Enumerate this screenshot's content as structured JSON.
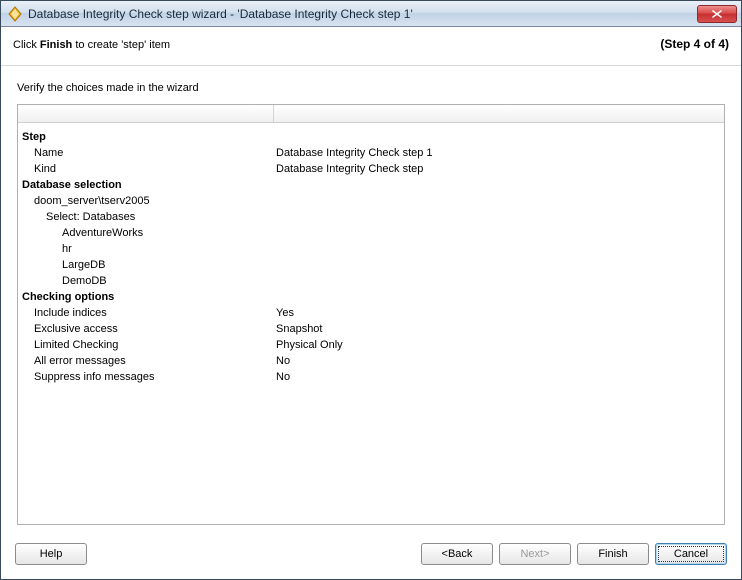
{
  "window": {
    "title": "Database Integrity Check step wizard - 'Database Integrity Check step 1'"
  },
  "subheader": {
    "prefix": "Click ",
    "bold": "Finish",
    "suffix": " to create 'step' item",
    "step": "(Step 4 of 4)"
  },
  "content": {
    "verify_label": "Verify the choices made in the wizard"
  },
  "summary": {
    "step_header": "Step",
    "name_label": "Name",
    "name_value": "Database Integrity Check step 1",
    "kind_label": "Kind",
    "kind_value": "Database Integrity Check step",
    "db_header": "Database selection",
    "server": "doom_server\\tserv2005",
    "select_label": "Select: Databases",
    "databases": [
      "AdventureWorks",
      "hr",
      "LargeDB",
      "DemoDB"
    ],
    "opts_header": "Checking options",
    "options": [
      {
        "label": "Include indices",
        "value": "Yes"
      },
      {
        "label": "Exclusive access",
        "value": "Snapshot"
      },
      {
        "label": "Limited Checking",
        "value": "Physical Only"
      },
      {
        "label": "All error messages",
        "value": "No"
      },
      {
        "label": "Suppress info messages",
        "value": "No"
      }
    ]
  },
  "buttons": {
    "help": "Help",
    "back": "<Back",
    "next": "Next>",
    "finish": "Finish",
    "cancel": "Cancel"
  }
}
